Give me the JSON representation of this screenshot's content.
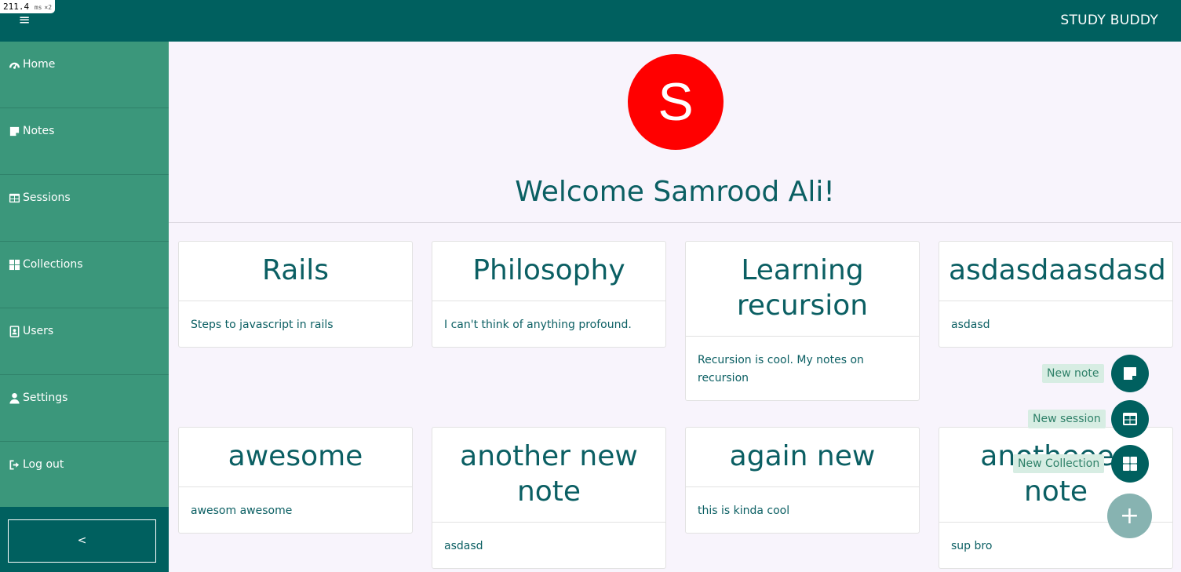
{
  "perf": {
    "value": "211.4",
    "unit": "ms",
    "multiplier": "×2"
  },
  "header": {
    "menu_glyph": "≡",
    "brand": "STUDY BUDDY"
  },
  "sidebar": {
    "items": [
      {
        "label": "Home",
        "icon": "dashboard-icon"
      },
      {
        "label": "Notes",
        "icon": "sticky-note-icon"
      },
      {
        "label": "Sessions",
        "icon": "table-icon"
      },
      {
        "label": "Collections",
        "icon": "grid-icon"
      },
      {
        "label": "Users",
        "icon": "id-badge-icon"
      },
      {
        "label": "Settings",
        "icon": "user-icon"
      },
      {
        "label": "Log out",
        "icon": "sign-out-icon"
      }
    ],
    "collapse_label": "<"
  },
  "main": {
    "avatar_letter": "S",
    "avatar_color": "#ff0000",
    "welcome": "Welcome Samrood Ali!",
    "cards": [
      {
        "title": "Rails",
        "body": "Steps to javascript in rails"
      },
      {
        "title": "Philosophy",
        "body": "I can't think of anything profound."
      },
      {
        "title": "Learning recursion",
        "body": "Recursion is cool. My notes on recursion"
      },
      {
        "title": "asdasdaasdasd",
        "body": "asdasd"
      },
      {
        "title": "awesome",
        "body": "awesom awesome"
      },
      {
        "title": "another new note",
        "body": "asdasd"
      },
      {
        "title": "again new",
        "body": "this is kinda cool"
      },
      {
        "title": "anotheeee note",
        "body": "sup bro"
      }
    ]
  },
  "fab": {
    "actions": [
      {
        "label": "New note",
        "icon": "note-icon"
      },
      {
        "label": "New session",
        "icon": "table-icon"
      },
      {
        "label": "New Collection",
        "icon": "grid-icon"
      }
    ],
    "main_glyph": "+"
  },
  "colors": {
    "primary": "#00605f",
    "sidebar": "#3b977b",
    "accent_text": "#0b5f63",
    "avatar": "#ff0000"
  }
}
